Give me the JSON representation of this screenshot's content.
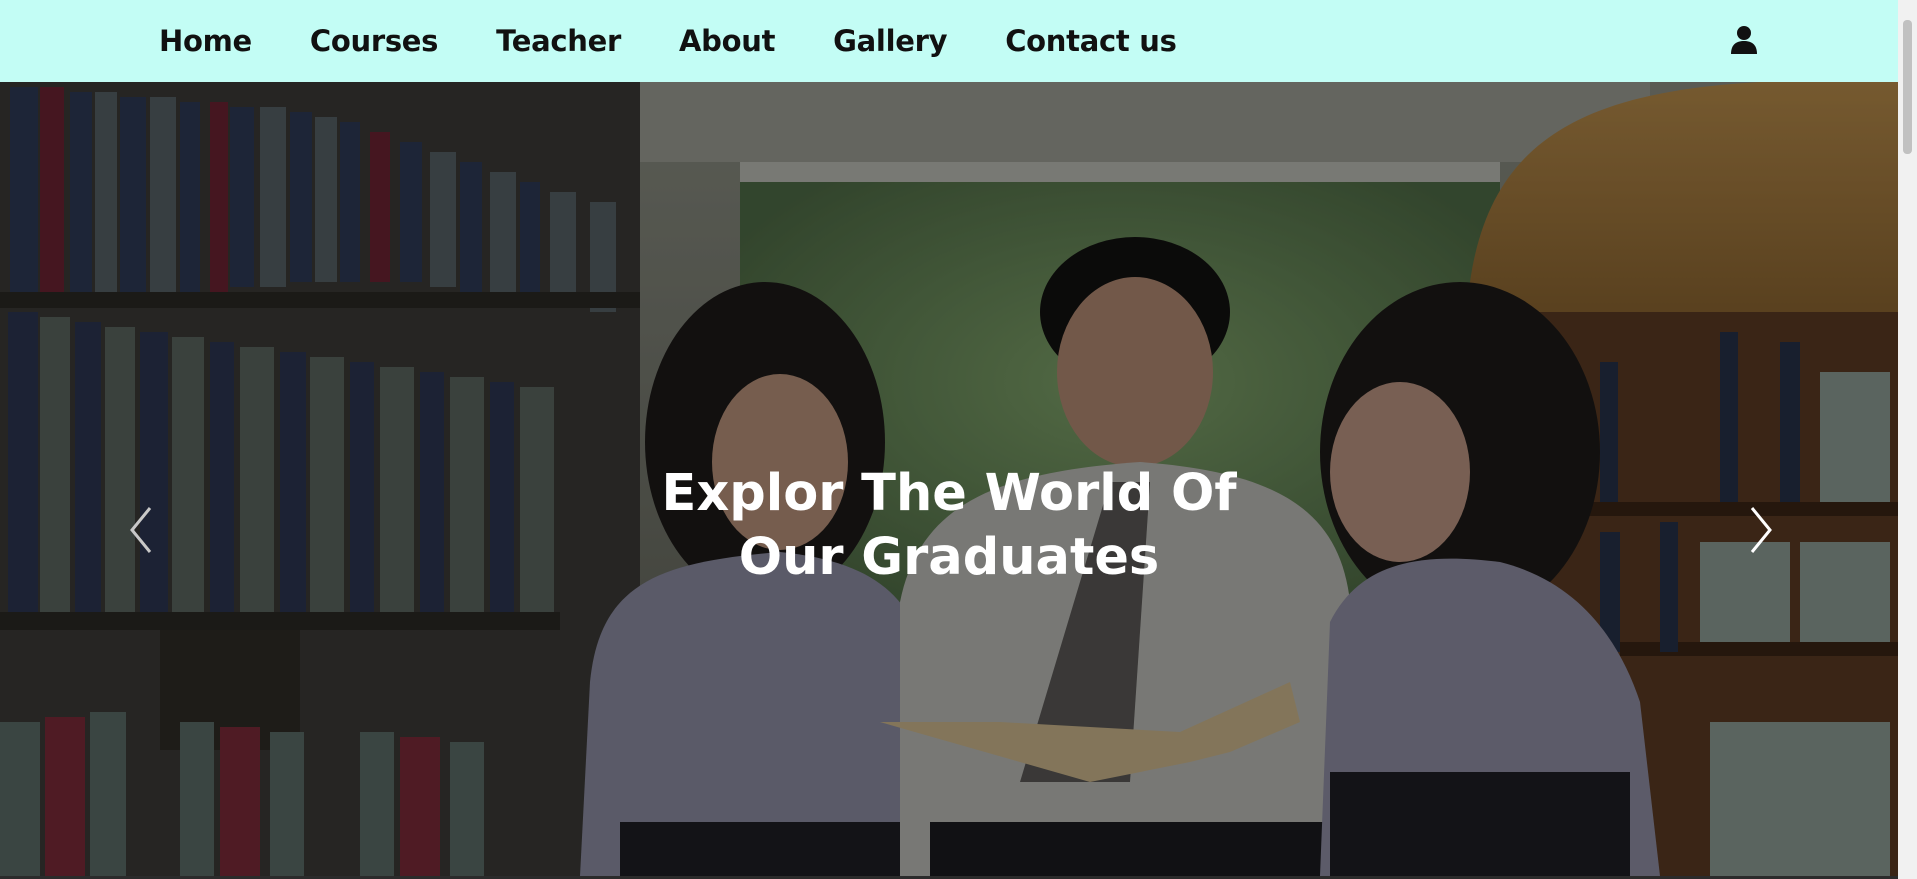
{
  "nav": {
    "items": [
      {
        "label": "Home"
      },
      {
        "label": "Courses"
      },
      {
        "label": "Teacher"
      },
      {
        "label": "About"
      },
      {
        "label": "Gallery"
      },
      {
        "label": "Contact us"
      }
    ],
    "user_icon": "user-icon",
    "background": "#c3fdf5"
  },
  "hero": {
    "title_line1": "Explor The World Of",
    "title_line2": "Our Graduates",
    "prev_icon": "chevron-left-icon",
    "next_icon": "chevron-right-icon"
  }
}
